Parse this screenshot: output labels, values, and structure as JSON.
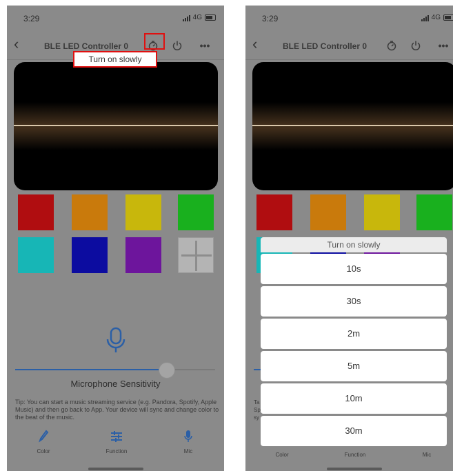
{
  "left": {
    "status": {
      "time": "3:29",
      "network": "4G"
    },
    "nav": {
      "back": "‹",
      "title": "BLE LED Controller 0",
      "more": "•••"
    },
    "tooltip": "Turn on slowly",
    "sensitivity_label": "Microphone Sensitivity",
    "sensitivity_level": 0.73,
    "tip": "Tip: You can start a music streaming service (e.g. Pandora, Spotify, Apple Music) and then go back to App. Your device will sync and change color to the beat of the music.",
    "tabs": [
      {
        "label": "Color",
        "icon": "dropper-icon"
      },
      {
        "label": "Function",
        "icon": "sliders-icon"
      },
      {
        "label": "Mic",
        "icon": "microphone-icon"
      }
    ],
    "swatches": [
      "#b00d10",
      "#c97a0c",
      "#c8b70c",
      "#19b01e",
      "#17b6b6",
      "#0c0ca0",
      "#6d159c"
    ]
  },
  "right": {
    "status": {
      "time": "3:29",
      "network": "4G"
    },
    "nav": {
      "back": "‹",
      "title": "BLE LED Controller 0",
      "more": "•••"
    },
    "sheet": {
      "title": "Turn on slowly",
      "options": [
        "10s",
        "30s",
        "2m",
        "5m",
        "10m",
        "30m"
      ]
    },
    "tabs": [
      {
        "label": "Color"
      },
      {
        "label": "Function"
      },
      {
        "label": "Mic"
      }
    ],
    "tip_prefix": [
      "Ta",
      "Sp",
      "sy"
    ]
  },
  "colors": {
    "accent": "#2b5fa6",
    "highlight": "#e01010",
    "overlay_bg": "#8a8a8a"
  }
}
